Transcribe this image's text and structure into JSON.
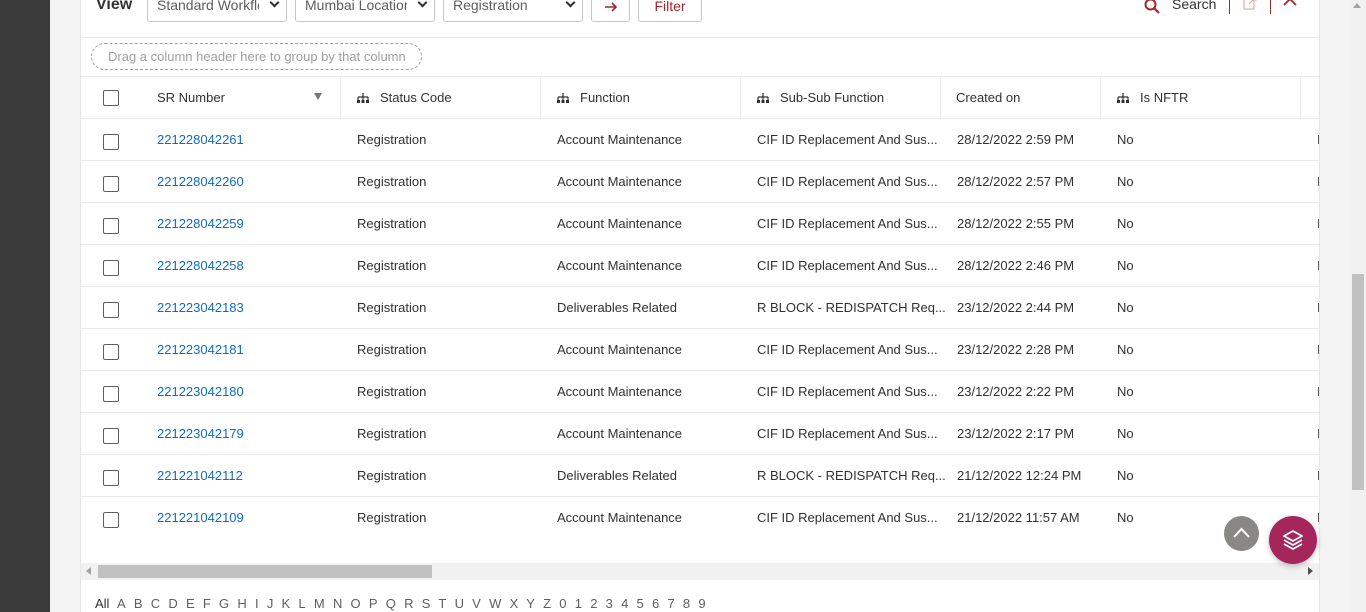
{
  "toolbar": {
    "view_label": "View",
    "dropdowns": [
      {
        "value": "Standard Workflow"
      },
      {
        "value": "Mumbai Location A"
      },
      {
        "value": "Registration"
      }
    ],
    "go_icon": "arrow-right-icon",
    "filter_label": "Filter",
    "search_label": "Search"
  },
  "group_hint": "Drag a column header here to group by that column",
  "columns": [
    {
      "label": "SR Number",
      "icon": "sort-desc-icon"
    },
    {
      "label": "Status Code",
      "icon": "hierarchy-icon"
    },
    {
      "label": "Function",
      "icon": "hierarchy-icon"
    },
    {
      "label": "Sub-Sub Function",
      "icon": "hierarchy-icon"
    },
    {
      "label": "Created on"
    },
    {
      "label": "Is NFTR",
      "icon": "hierarchy-icon"
    }
  ],
  "rows": [
    {
      "sr": "221228042261",
      "status": "Registration",
      "function": "Account Maintenance",
      "subsub": "CIF ID Replacement And Sus...",
      "created": "28/12/2022 2:59 PM",
      "nftr": "No",
      "next": "I"
    },
    {
      "sr": "221228042260",
      "status": "Registration",
      "function": "Account Maintenance",
      "subsub": "CIF ID Replacement And Sus...",
      "created": "28/12/2022 2:57 PM",
      "nftr": "No",
      "next": "I"
    },
    {
      "sr": "221228042259",
      "status": "Registration",
      "function": "Account Maintenance",
      "subsub": "CIF ID Replacement And Sus...",
      "created": "28/12/2022 2:55 PM",
      "nftr": "No",
      "next": "I"
    },
    {
      "sr": "221228042258",
      "status": "Registration",
      "function": "Account Maintenance",
      "subsub": "CIF ID Replacement And Sus...",
      "created": "28/12/2022 2:46 PM",
      "nftr": "No",
      "next": "I"
    },
    {
      "sr": "221223042183",
      "status": "Registration",
      "function": "Deliverables Related",
      "subsub": "R BLOCK - REDISPATCH Req...",
      "created": "23/12/2022 2:44 PM",
      "nftr": "No",
      "next": "I"
    },
    {
      "sr": "221223042181",
      "status": "Registration",
      "function": "Account Maintenance",
      "subsub": "CIF ID Replacement And Sus...",
      "created": "23/12/2022 2:28 PM",
      "nftr": "No",
      "next": "I"
    },
    {
      "sr": "221223042180",
      "status": "Registration",
      "function": "Account Maintenance",
      "subsub": "CIF ID Replacement And Sus...",
      "created": "23/12/2022 2:22 PM",
      "nftr": "No",
      "next": "I"
    },
    {
      "sr": "221223042179",
      "status": "Registration",
      "function": "Account Maintenance",
      "subsub": "CIF ID Replacement And Sus...",
      "created": "23/12/2022 2:17 PM",
      "nftr": "No",
      "next": "I"
    },
    {
      "sr": "221221042112",
      "status": "Registration",
      "function": "Deliverables Related",
      "subsub": "R BLOCK - REDISPATCH Req...",
      "created": "21/12/2022 12:24 PM",
      "nftr": "No",
      "next": "I"
    },
    {
      "sr": "221221042109",
      "status": "Registration",
      "function": "Account Maintenance",
      "subsub": "CIF ID Replacement And Sus...",
      "created": "21/12/2022 11:57 AM",
      "nftr": "No",
      "next": "I"
    }
  ],
  "alpha_filter": [
    "All",
    "A",
    "B",
    "C",
    "D",
    "E",
    "F",
    "G",
    "H",
    "I",
    "J",
    "K",
    "L",
    "M",
    "N",
    "O",
    "P",
    "Q",
    "R",
    "S",
    "T",
    "U",
    "V",
    "W",
    "X",
    "Y",
    "Z",
    "0",
    "1",
    "2",
    "3",
    "4",
    "5",
    "6",
    "7",
    "8",
    "9"
  ],
  "colors": {
    "accent": "#a4262c",
    "link": "#0f6cbd",
    "fab": "#a4265a"
  },
  "fab": {
    "scroll_top_icon": "chevron-up-icon",
    "layers_icon": "layers-icon"
  }
}
